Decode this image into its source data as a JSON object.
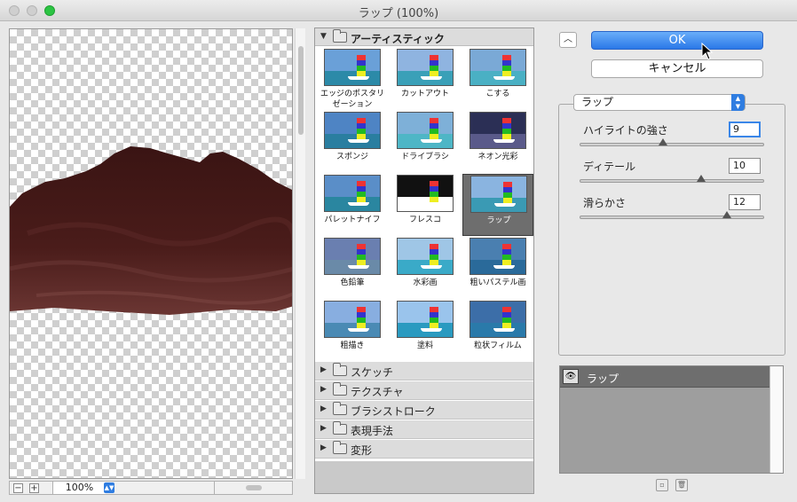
{
  "window": {
    "title": "ラップ (100%)"
  },
  "preview": {
    "zoom": "100%"
  },
  "browser": {
    "open_category": "アーティスティック",
    "filters": [
      {
        "name": "エッジのポスタリゼーション"
      },
      {
        "name": "カットアウト"
      },
      {
        "name": "こする"
      },
      {
        "name": "スポンジ"
      },
      {
        "name": "ドライブラシ"
      },
      {
        "name": "ネオン光彩"
      },
      {
        "name": "パレットナイフ"
      },
      {
        "name": "フレスコ"
      },
      {
        "name": "ラップ"
      },
      {
        "name": "色鉛筆"
      },
      {
        "name": "水彩画"
      },
      {
        "name": "粗いパステル画"
      },
      {
        "name": "粗描き"
      },
      {
        "name": "塗料"
      },
      {
        "name": "粒状フィルム"
      }
    ],
    "selected_filter": "ラップ",
    "categories": [
      "スケッチ",
      "テクスチャ",
      "ブラシストローク",
      "表現手法",
      "変形"
    ]
  },
  "buttons": {
    "ok": "OK",
    "cancel": "キャンセル"
  },
  "filter_select": {
    "value": "ラップ"
  },
  "params": {
    "highlight": {
      "label": "ハイライトの強さ",
      "value": "9",
      "fraction": 0.45
    },
    "detail": {
      "label": "ディテール",
      "value": "10",
      "fraction": 0.66
    },
    "smoothness": {
      "label": "滑らかさ",
      "value": "12",
      "fraction": 0.8
    }
  },
  "layers": {
    "row_name": "ラップ"
  },
  "colors": {
    "accent": "#2a78e8",
    "selected": "#6e6e6e"
  }
}
